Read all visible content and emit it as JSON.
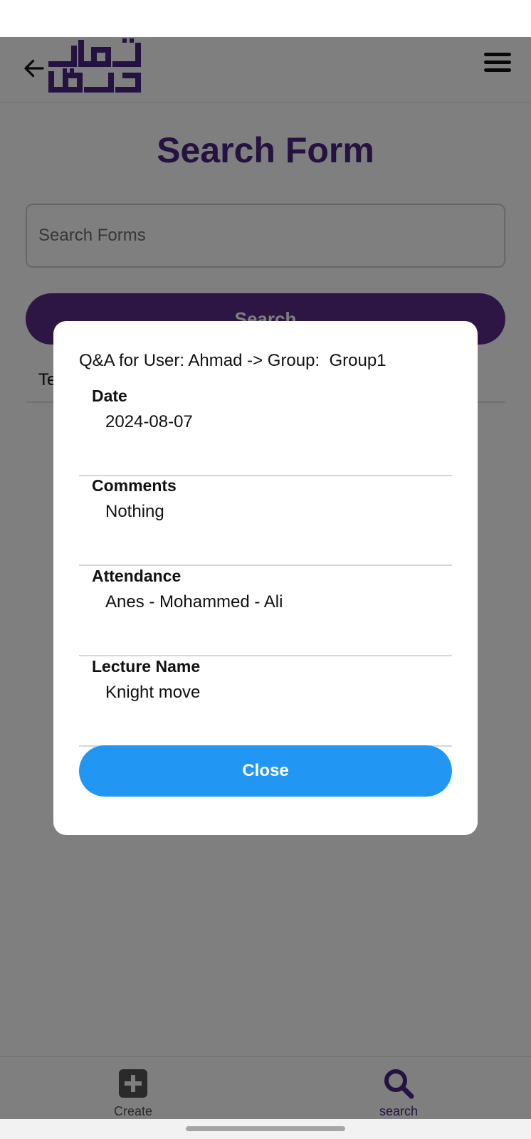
{
  "header": {
    "back_icon": "arrow-left-icon",
    "menu_icon": "hamburger-menu-icon",
    "logo_text": "شطرنج القدس",
    "brand_color": "#4b2580"
  },
  "page": {
    "title": "Search Form"
  },
  "search": {
    "placeholder": "Search Forms",
    "value": "",
    "button_label": "Search"
  },
  "results": {
    "first_row_partial_text": "Te"
  },
  "dialog": {
    "title": "Q&A for User: Ahmad -> Group:  Group1",
    "fields": [
      {
        "label": "Date",
        "value": "2024-08-07"
      },
      {
        "label": "Comments",
        "value": "Nothing"
      },
      {
        "label": "Attendance",
        "value": "Anes - Mohammed - Ali"
      },
      {
        "label": "Lecture Name",
        "value": "Knight move"
      }
    ],
    "close_label": "Close",
    "close_color": "#2196f3"
  },
  "bottom_nav": {
    "items": [
      {
        "label": "Create",
        "icon": "plus-square-icon"
      },
      {
        "label": "search",
        "icon": "magnifier-icon"
      }
    ]
  }
}
